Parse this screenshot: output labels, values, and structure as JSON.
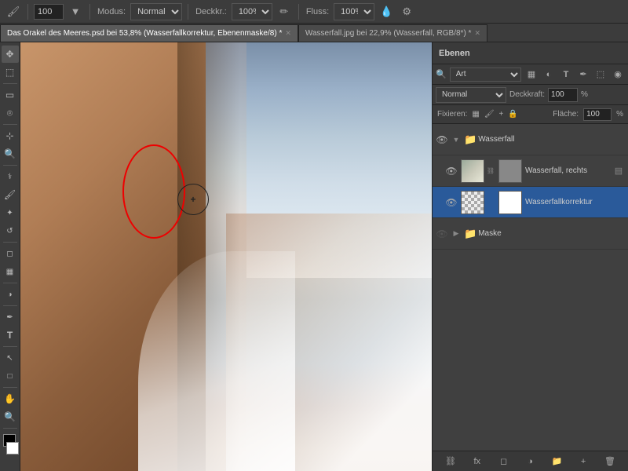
{
  "toolbar": {
    "brush_size": "100",
    "mode_label": "Modus:",
    "mode_value": "Normal",
    "opacity_label": "Deckkr.:",
    "opacity_value": "100%",
    "flow_label": "Fluss:",
    "flow_value": "100%"
  },
  "tabs": [
    {
      "id": "tab1",
      "label": "Das Orakel des Meeres.psd bei 53,8% (Wasserfallkorrektur, Ebenenmaske/8) *",
      "active": true
    },
    {
      "id": "tab2",
      "label": "Wasserfall.jpg bei 22,9% (Wasserfall, RGB/8*) *",
      "active": false
    }
  ],
  "layers_panel": {
    "title": "Ebenen",
    "search_placeholder": "Art",
    "mode_value": "Normal",
    "opacity_label": "Deckkraft:",
    "opacity_value": "100%",
    "fixieren_label": "Fixieren:",
    "flaeche_label": "Fläche:",
    "flaeche_value": "100%",
    "layers": [
      {
        "id": "wasserfall-group",
        "name": "Wasserfall",
        "type": "group",
        "visible": true,
        "expanded": true,
        "selected": false
      },
      {
        "id": "wasserfall-rechts",
        "name": "Wasserfall, rechts",
        "type": "layer",
        "visible": true,
        "selected": false
      },
      {
        "id": "wasserfallkorrektur",
        "name": "Wasserfallkorrektur",
        "type": "layer",
        "visible": true,
        "selected": true
      },
      {
        "id": "maske-group",
        "name": "Maske",
        "type": "group",
        "visible": false,
        "expanded": false,
        "selected": false
      }
    ]
  },
  "canvas": {
    "red_circle_visible": true,
    "brush_cursor_visible": true
  }
}
